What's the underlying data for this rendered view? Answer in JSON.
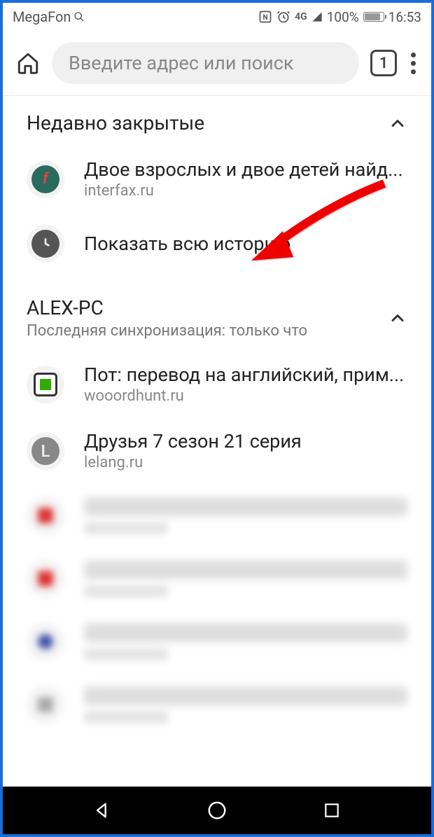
{
  "statusbar": {
    "carrier": "MegaFon",
    "network": "4G",
    "battery": "100%",
    "time": "16:53"
  },
  "toolbar": {
    "placeholder": "Введите адрес или поиск",
    "tab_count": "1"
  },
  "sections": {
    "recent": {
      "title": "Недавно закрытые",
      "items": [
        {
          "title": "Двое взрослых и двое детей найд...",
          "domain": "interfax.ru"
        }
      ],
      "show_all": "Показать всю историю"
    },
    "synced": {
      "title": "ALEX-PC",
      "subtitle": "Последняя синхронизация: только что",
      "items": [
        {
          "title": "Пот: перевод на английский, прим...",
          "domain": "wooordhunt.ru"
        },
        {
          "title": "Друзья 7 сезон 21 серия",
          "domain": "lelang.ru"
        }
      ]
    }
  }
}
